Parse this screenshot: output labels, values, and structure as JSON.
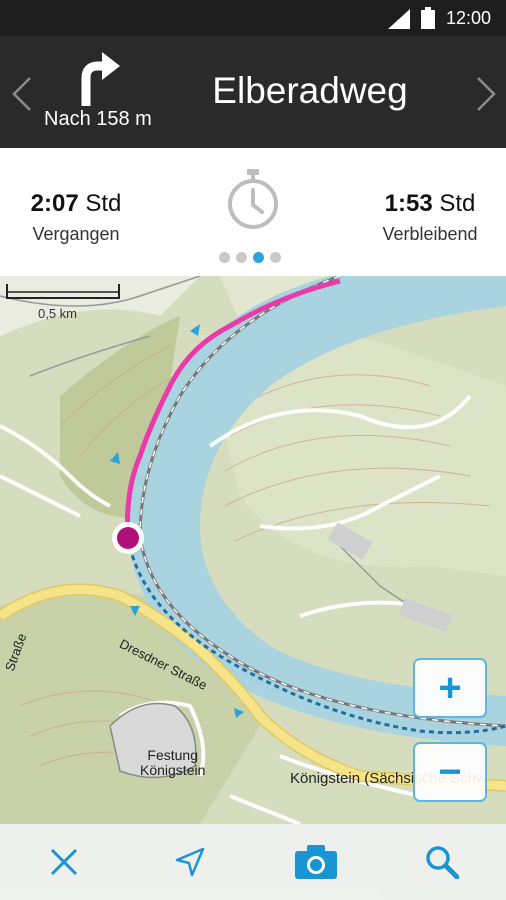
{
  "status_bar": {
    "time": "12:00",
    "icons": [
      "signal-icon",
      "battery-icon"
    ]
  },
  "navigation": {
    "distance": "Nach 158 m",
    "route_name": "Elberadweg",
    "turn_icon": "turn-right-arrow-icon"
  },
  "times": {
    "elapsed_value": "2:07",
    "elapsed_unit": " Std",
    "elapsed_label": "Vergangen",
    "remaining_value": "1:53",
    "remaining_unit": " Std",
    "remaining_label": "Verbleibend",
    "pager": {
      "count": 4,
      "active_index": 2
    }
  },
  "map": {
    "scale": "0,5 km",
    "labels": {
      "festung_line1": "Festung",
      "festung_line2": "Königstein",
      "town": "Königstein (Sächsische Schw",
      "road": "Dresdner Straße",
      "road_left": "Straße"
    },
    "zoom_in_label": "+",
    "zoom_out_label": "−",
    "colors": {
      "river": "#a9d3df",
      "track_done": "#e83aa8",
      "track_remaining": "#1e6fa0",
      "current_position": "#b0107a",
      "road": "#f6e48a"
    }
  },
  "toolbar": {
    "items": [
      "close-icon",
      "locate-arrow-icon",
      "camera-icon",
      "search-icon"
    ],
    "accent": "#1a95d4"
  }
}
